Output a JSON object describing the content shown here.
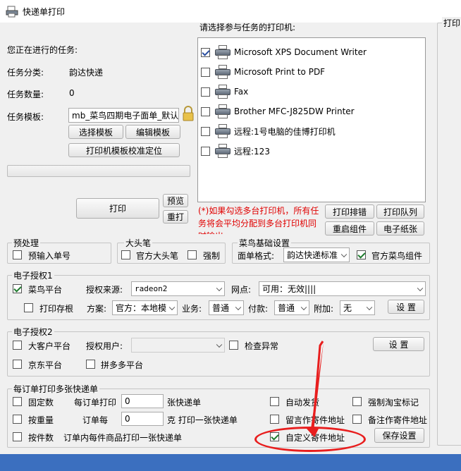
{
  "window": {
    "title": "快递单打印"
  },
  "left": {
    "current_task_label": "您正在进行的任务:",
    "category_label": "任务分类:",
    "category_value": "韵达快递",
    "count_label": "任务数量:",
    "count_value": "0",
    "template_label": "任务模板:",
    "template_value": "mb_菜鸟四期电子面单_默认",
    "select_template": "选择模板",
    "edit_template": "编辑模板",
    "calibrate": "打印机模板校准定位",
    "print": "打印",
    "preview": "预览",
    "reprint": "重打"
  },
  "printers": {
    "heading": "请选择参与任务的打印机:",
    "items": [
      {
        "name": "Microsoft XPS Document Writer",
        "checked": true
      },
      {
        "name": "Microsoft Print to PDF",
        "checked": false
      },
      {
        "name": "Fax",
        "checked": false
      },
      {
        "name": "Brother MFC-J825DW Printer",
        "checked": false
      },
      {
        "name": "远程:1号电脑的佳博打印机",
        "checked": false
      },
      {
        "name": "远程:123",
        "checked": false
      }
    ],
    "note": "(*)如果勾选多台打印机，所有任务将会平均分配到多台打印机同时输出",
    "btn_sort": "打印排错",
    "btn_queue": "打印队列",
    "btn_restart": "重启组件",
    "btn_paper": "电子纸张"
  },
  "right_panel": {
    "title": "打印"
  },
  "preprocess": {
    "title": "预处理",
    "input_order": "预输入单号"
  },
  "big_pen": {
    "title": "大头笔",
    "official": "官方大头笔",
    "force": "强制"
  },
  "cainiao": {
    "title": "菜鸟基础设置",
    "format_label": "面单格式:",
    "format_value": "韵达快递标准",
    "official_component": "官方菜鸟组件"
  },
  "auth1": {
    "title": "电子授权1",
    "platform": "菜鸟平台",
    "source_label": "授权来源:",
    "source_value": "radeon2",
    "branch_label": "网点:",
    "branch_value": "可用：无效||||",
    "print_stub": "打印存根",
    "plan_label": "方案:",
    "plan_value": "官方：本地模",
    "business_label": "业务:",
    "business_value": "普通",
    "pay_label": "付款:",
    "pay_value": "普通",
    "extra_label": "附加:",
    "extra_value": "无",
    "settings": "设 置"
  },
  "auth2": {
    "title": "电子授权2",
    "big_customer": "大客户平台",
    "auth_user_label": "授权用户:",
    "auth_user_value": "",
    "check_abnormal": "检查异常",
    "settings": "设 置",
    "jd": "京东平台",
    "pdd": "拼多多平台"
  },
  "multi": {
    "title": "每订单打印多张快递单",
    "fixed_count": "固定数",
    "per_order_print": "每订单打印",
    "per_order_print_value": "0",
    "sheets": "张快递单",
    "by_weight": "按重量",
    "per_order_each": "订单每",
    "per_order_each_value": "0",
    "kg_print": "克 打印一张快递单",
    "by_items": "按件数",
    "per_item_note": "订单内每件商品打印一张快递单",
    "auto_ship": "自动发货",
    "force_taobao": "强制淘宝标记",
    "note_sender": "留言作寄件地址",
    "remark_sender": "备注作寄件地址",
    "custom_sender": "自定义寄件地址",
    "save": "保存设置"
  },
  "colors": {
    "annotation": "#e81e1e",
    "statusbar": "#3b6fbf",
    "note": "#e00000"
  }
}
